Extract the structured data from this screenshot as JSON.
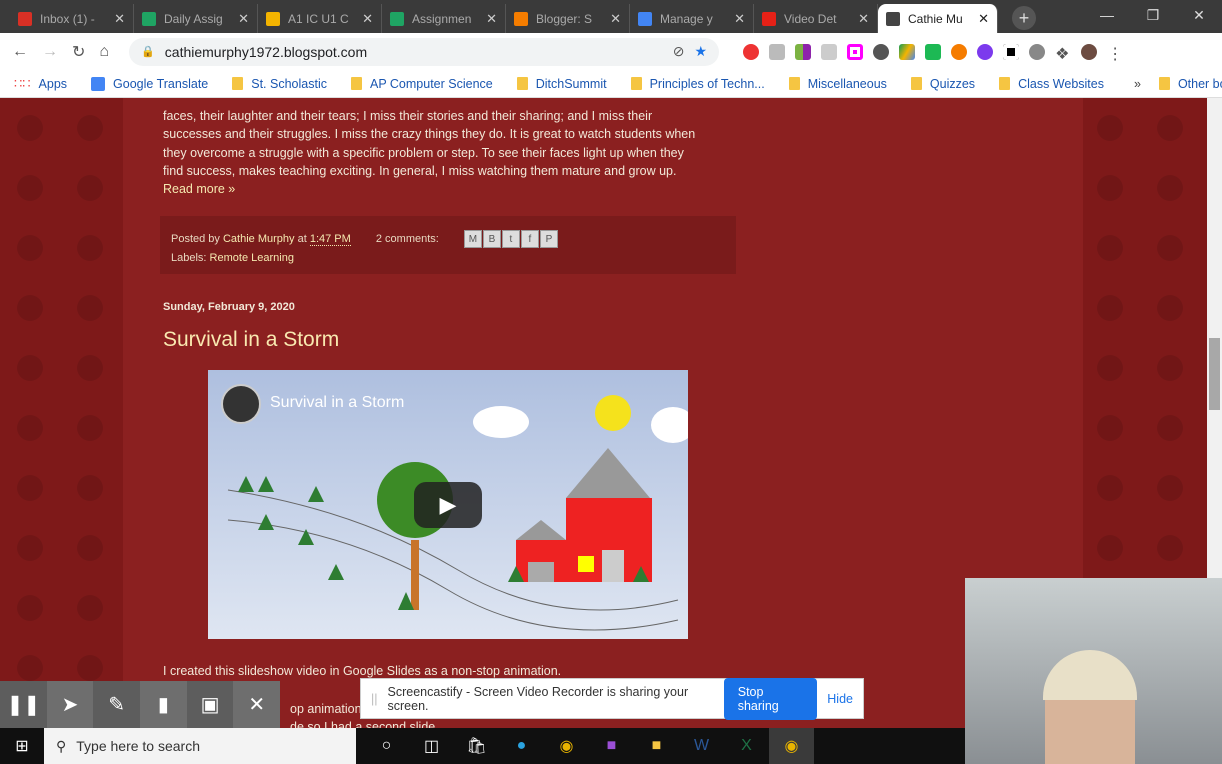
{
  "browser": {
    "tabs": [
      {
        "title": "Inbox (1) -",
        "icon": "gmail-icon",
        "color": "#d93025"
      },
      {
        "title": "Daily Assig",
        "icon": "drive-icon",
        "color": "#1fa463"
      },
      {
        "title": "A1 IC U1 C",
        "icon": "slides-icon",
        "color": "#f4b400"
      },
      {
        "title": "Assignmen",
        "icon": "drive-icon",
        "color": "#1fa463"
      },
      {
        "title": "Blogger: S",
        "icon": "blogger-icon",
        "color": "#f57d00"
      },
      {
        "title": "Manage y",
        "icon": "google-icon",
        "color": "#4285f4"
      },
      {
        "title": "Video Det",
        "icon": "youtube-studio-icon",
        "color": "#e62117"
      },
      {
        "title": "Cathie Mu",
        "icon": "blog-favicon",
        "color": "#444444",
        "active": true
      }
    ],
    "url": "cathiemurphy1972.blogspot.com",
    "bookmarks": [
      {
        "label": "Apps",
        "icon": "apps-icon"
      },
      {
        "label": "Google Translate",
        "icon": "translate-icon"
      },
      {
        "label": "St. Scholastic",
        "icon": "folder-icon"
      },
      {
        "label": "AP Computer Science",
        "icon": "folder-icon"
      },
      {
        "label": "DitchSummit",
        "icon": "folder-icon"
      },
      {
        "label": "Principles of Techn...",
        "icon": "folder-icon"
      },
      {
        "label": "Miscellaneous",
        "icon": "folder-icon"
      },
      {
        "label": "Quizzes",
        "icon": "folder-icon"
      },
      {
        "label": "Class Websites",
        "icon": "folder-icon"
      }
    ],
    "more_bookmarks": "»",
    "other_bookmarks": "Other bookmarks"
  },
  "post1": {
    "lines": [
      "faces, their laughter and their tears; I miss their stories and their sharing; and I miss their",
      "successes and their struggles. I miss the crazy things they do. It is great to watch students when",
      "they overcome a struggle with a specific problem or step. To see their faces light up when they",
      "find success, makes teaching exciting. In general, I miss watching them mature and grow up."
    ],
    "read_more": "Read more »",
    "posted_by": "Posted by",
    "author": "Cathie Murphy",
    "at": "at",
    "time": "1:47 PM",
    "comments": "2 comments:",
    "labels_prefix": "Labels:",
    "label": "Remote Learning"
  },
  "post2": {
    "date": "Sunday, February 9, 2020",
    "title": "Survival in a Storm",
    "video_title": "Survival in a Storm",
    "body1": "I created this slideshow video in Google Slides as a non-stop animation.",
    "body2_fragment": "op animation b",
    "body3_fragment": "de so I had a second slide."
  },
  "screencastify": {
    "notice": "Screencastify - Screen Video Recorder is sharing your screen.",
    "stop": "Stop sharing",
    "hide": "Hide"
  },
  "taskbar": {
    "search_placeholder": "Type here to search"
  }
}
